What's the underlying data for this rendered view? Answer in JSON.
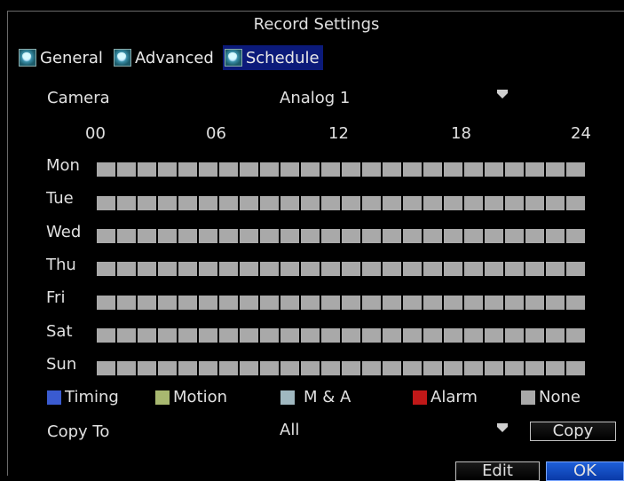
{
  "window": {
    "title": "Record Settings"
  },
  "tabs": [
    {
      "label": "General",
      "icon": "camera-tab-icon",
      "active": false
    },
    {
      "label": "Advanced",
      "icon": "camera-tab-icon",
      "active": false
    },
    {
      "label": "Schedule",
      "icon": "camera-tab-icon",
      "active": true
    }
  ],
  "camera": {
    "label": "Camera",
    "value": "Analog 1"
  },
  "hours": [
    "00",
    "06",
    "12",
    "18",
    "24"
  ],
  "schedule": {
    "days": [
      "Mon",
      "Tue",
      "Wed",
      "Thu",
      "Fri",
      "Sat",
      "Sun"
    ],
    "slots_per_day": 24,
    "fill_mode": "None"
  },
  "legend": [
    {
      "label": "Timing",
      "color": "#3a5bd0"
    },
    {
      "label": "Motion",
      "color": "#a8b870"
    },
    {
      "label": "M & A",
      "color": "#a0b8c0"
    },
    {
      "label": "Alarm",
      "color": "#c01818"
    },
    {
      "label": "None",
      "color": "#a9a9a9"
    }
  ],
  "copy": {
    "label": "Copy To",
    "value": "All",
    "button": "Copy"
  },
  "footer": {
    "edit": "Edit",
    "ok": "OK"
  }
}
